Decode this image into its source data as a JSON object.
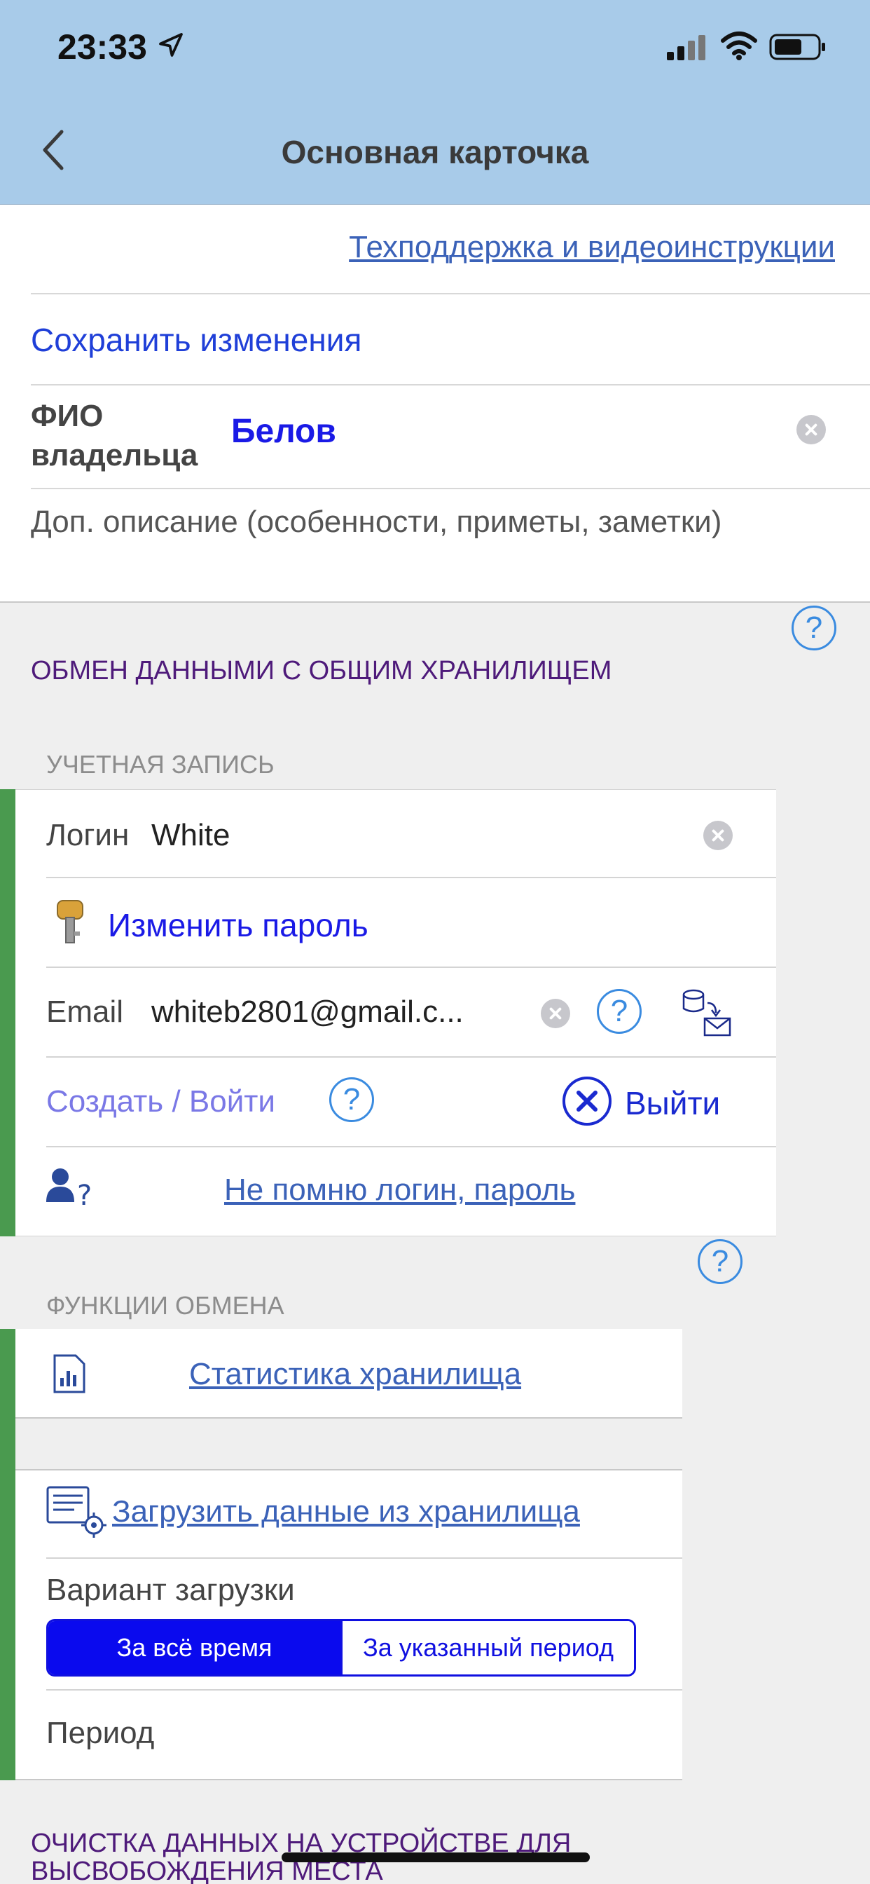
{
  "status": {
    "time": "23:33"
  },
  "nav": {
    "title": "Основная карточка"
  },
  "card": {
    "support_link": "Техподдержка и видеоинструкции",
    "save_label": "Сохранить изменения",
    "owner_label_line1": "ФИО",
    "owner_label_line2": "владельца",
    "owner_value": "Белов",
    "description_placeholder": "Доп. описание (особенности, приметы, заметки)"
  },
  "exchange": {
    "section_title": "ОБМЕН ДАННЫМИ С ОБЩИМ ХРАНИЛИЩЕМ",
    "account_header": "УЧЕТНАЯ ЗАПИСЬ",
    "login_label": "Логин",
    "login_value": "White",
    "change_password": "Изменить пароль",
    "email_label": "Email",
    "email_value": "whiteb2801@gmail.c...",
    "create_login": "Создать / Войти",
    "logout": "Выйти",
    "forgot_link": "Не помню логин, пароль"
  },
  "functions": {
    "header": "ФУНКЦИИ ОБМЕНА",
    "stats_link": "Статистика хранилища",
    "load_link": "Загрузить данные из хранилища",
    "variant_label": "Вариант загрузки",
    "options": [
      "За всё время",
      "За указанный период"
    ],
    "selected_option": "За всё время",
    "period_label": "Период"
  },
  "cleanup": {
    "title_line1": "ОЧИСТКА ДАННЫХ НА УСТРОЙСТВЕ ДЛЯ",
    "title_line2": "ВЫСВОБОЖДЕНИЯ МЕСТА"
  },
  "colors": {
    "header_bg": "#a8cbe9",
    "accent_blue": "#1f3fd8",
    "link": "#3b62b8",
    "green_bar": "#4a9a4f",
    "section_purple": "#4e1a7a"
  }
}
